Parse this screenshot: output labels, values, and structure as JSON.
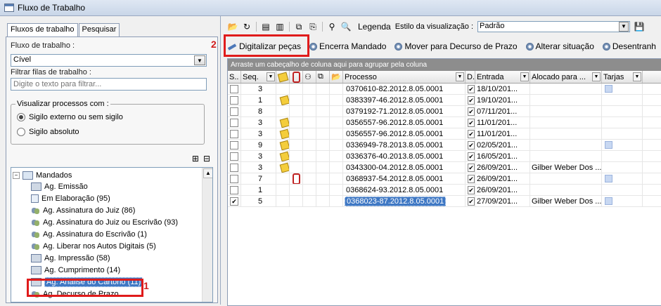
{
  "window": {
    "title": "Fluxo de Trabalho"
  },
  "left": {
    "tabs": [
      {
        "label": "Fluxos de trabalho"
      },
      {
        "label": "Pesquisar"
      }
    ],
    "workflow_label": "Fluxo de trabalho :",
    "workflow_value": "Cível",
    "filter_label": "Filtrar filas de trabalho :",
    "filter_placeholder": "Digite o texto para filtrar...",
    "visibility_group": "Visualizar processos com :",
    "radio_external": "Sigilo externo ou sem sigilo",
    "radio_absolute": "Sigilo absoluto",
    "tree": {
      "root": "Mandados",
      "items": [
        "Ag. Emissão",
        "Em Elaboração (95)",
        "Ag. Assinatura do Juiz (86)",
        "Ag. Assinatura do Juiz ou Escrivão (93)",
        "Ag. Assinatura do Escrivão (1)",
        "Ag. Liberar nos Autos Digitais (5)",
        "Ag. Impressão (58)",
        "Ag. Cumprimento (14)",
        "Ag. Análise do Cartório (11)",
        "Ag. Decurso de Prazo"
      ]
    }
  },
  "annotations": {
    "one": "1",
    "two": "2"
  },
  "right": {
    "toolbar": {
      "legend": "Legenda",
      "style_label": "Estilo da visualização :",
      "style_value": "Padrão"
    },
    "actions": [
      "Digitalizar peças",
      "Encerra Mandado",
      "Mover para Decurso de Prazo",
      "Alterar situação",
      "Desentranh"
    ],
    "group_hint": "Arraste um cabeçalho de coluna aqui para agrupar pela coluna",
    "columns": {
      "s": "S..",
      "seq": "Seq.",
      "processo": "Processo",
      "d": "D.",
      "entrada": "Entrada",
      "alocado": "Alocado para ...",
      "tarjas": "Tarjas"
    },
    "rows": [
      {
        "checked": false,
        "seq": "3",
        "note": false,
        "clip": false,
        "processo": "0370610-82.2012.8.05.0001",
        "d": true,
        "entrada": "18/10/201...",
        "alocado": "",
        "tarja": true,
        "selected": false
      },
      {
        "checked": false,
        "seq": "1",
        "note": true,
        "clip": false,
        "processo": "0383397-46.2012.8.05.0001",
        "d": true,
        "entrada": "19/10/201...",
        "alocado": "",
        "tarja": false,
        "selected": false
      },
      {
        "checked": false,
        "seq": "8",
        "note": false,
        "clip": false,
        "processo": "0379192-71.2012.8.05.0001",
        "d": true,
        "entrada": "07/11/201...",
        "alocado": "",
        "tarja": false,
        "selected": false
      },
      {
        "checked": false,
        "seq": "3",
        "note": true,
        "clip": false,
        "processo": "0356557-96.2012.8.05.0001",
        "d": true,
        "entrada": "11/01/201...",
        "alocado": "",
        "tarja": false,
        "selected": false
      },
      {
        "checked": false,
        "seq": "3",
        "note": true,
        "clip": false,
        "processo": "0356557-96.2012.8.05.0001",
        "d": true,
        "entrada": "11/01/201...",
        "alocado": "",
        "tarja": false,
        "selected": false
      },
      {
        "checked": false,
        "seq": "9",
        "note": true,
        "clip": false,
        "processo": "0336949-78.2013.8.05.0001",
        "d": true,
        "entrada": "02/05/201...",
        "alocado": "",
        "tarja": true,
        "selected": false
      },
      {
        "checked": false,
        "seq": "3",
        "note": true,
        "clip": false,
        "processo": "0336376-40.2013.8.05.0001",
        "d": true,
        "entrada": "16/05/201...",
        "alocado": "",
        "tarja": false,
        "selected": false
      },
      {
        "checked": false,
        "seq": "3",
        "note": true,
        "clip": false,
        "processo": "0343300-04.2012.8.05.0001",
        "d": true,
        "entrada": "26/09/201...",
        "alocado": "Gilber Weber Dos ...",
        "tarja": false,
        "selected": false
      },
      {
        "checked": false,
        "seq": "7",
        "note": false,
        "clip": true,
        "processo": "0368937-54.2012.8.05.0001",
        "d": true,
        "entrada": "26/09/201...",
        "alocado": "",
        "tarja": true,
        "selected": false
      },
      {
        "checked": false,
        "seq": "1",
        "note": false,
        "clip": false,
        "processo": "0368624-93.2012.8.05.0001",
        "d": true,
        "entrada": "26/09/201...",
        "alocado": "",
        "tarja": false,
        "selected": false
      },
      {
        "checked": true,
        "seq": "5",
        "note": false,
        "clip": false,
        "processo": "0368023-87.2012.8.05.0001",
        "d": true,
        "entrada": "27/09/201...",
        "alocado": "Gilber Weber Dos ...",
        "tarja": true,
        "selected": true
      }
    ]
  }
}
